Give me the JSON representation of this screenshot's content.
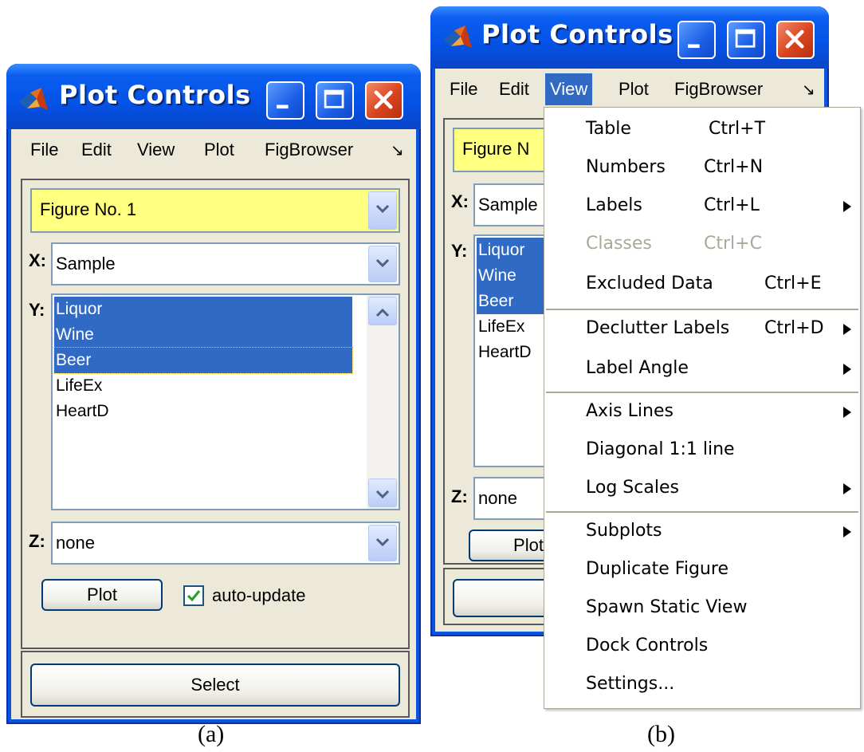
{
  "window_a": {
    "title": "Plot Controls",
    "menu": [
      "File",
      "Edit",
      "View",
      "Plot",
      "FigBrowser"
    ],
    "overflow_glyph": "↘",
    "figure_combo": "Figure No. 1",
    "x_label": "X:",
    "x_value": "Sample",
    "y_label": "Y:",
    "y_items": [
      {
        "text": "Liquor",
        "selected": true
      },
      {
        "text": "Wine",
        "selected": true
      },
      {
        "text": "Beer",
        "selected": true
      },
      {
        "text": "LifeEx",
        "selected": false
      },
      {
        "text": "HeartD",
        "selected": false
      }
    ],
    "z_label": "Z:",
    "z_value": "none",
    "plot_button": "Plot",
    "auto_update_label": "auto-update",
    "auto_update_checked": true,
    "select_button": "Select"
  },
  "window_b": {
    "title": "Plot Controls",
    "menu": [
      "File",
      "Edit",
      "View",
      "Plot",
      "FigBrowser"
    ],
    "active_menu": "View",
    "overflow_glyph": "↘",
    "figure_combo": "Figure N",
    "x_label": "X:",
    "x_value": "Sample",
    "y_label": "Y:",
    "y_items": [
      {
        "text": "Liquor",
        "selected": true
      },
      {
        "text": "Wine",
        "selected": true
      },
      {
        "text": "Beer",
        "selected": true
      },
      {
        "text": "LifeEx",
        "selected": false
      },
      {
        "text": "HeartD",
        "selected": false
      }
    ],
    "z_label": "Z:",
    "z_value": "none",
    "plot_button": "Plot"
  },
  "view_menu": {
    "items": [
      {
        "label": "Table",
        "shortcut": "Ctrl+T",
        "submenu": false,
        "disabled": false
      },
      {
        "label": "Numbers",
        "shortcut": "Ctrl+N",
        "submenu": false,
        "disabled": false
      },
      {
        "label": "Labels",
        "shortcut": "Ctrl+L",
        "submenu": true,
        "disabled": false
      },
      {
        "label": "Classes",
        "shortcut": "Ctrl+C",
        "submenu": false,
        "disabled": true
      },
      {
        "label": "Excluded Data",
        "shortcut": "Ctrl+E",
        "submenu": false,
        "disabled": false
      },
      {
        "label": "Declutter Labels",
        "shortcut": "Ctrl+D",
        "submenu": true,
        "disabled": false
      },
      {
        "label": "Label Angle",
        "shortcut": "",
        "submenu": true,
        "disabled": false
      },
      {
        "label": "Axis Lines",
        "shortcut": "",
        "submenu": true,
        "disabled": false
      },
      {
        "label": "Diagonal 1:1 line",
        "shortcut": "",
        "submenu": false,
        "disabled": false
      },
      {
        "label": "Log Scales",
        "shortcut": "",
        "submenu": true,
        "disabled": false
      },
      {
        "label": "Subplots",
        "shortcut": "",
        "submenu": true,
        "disabled": false
      },
      {
        "label": "Duplicate Figure",
        "shortcut": "",
        "submenu": false,
        "disabled": false
      },
      {
        "label": "Spawn Static View",
        "shortcut": "",
        "submenu": false,
        "disabled": false
      },
      {
        "label": "Dock Controls",
        "shortcut": "",
        "submenu": false,
        "disabled": false
      },
      {
        "label": "Settings...",
        "shortcut": "",
        "submenu": false,
        "disabled": false
      }
    ],
    "submenu_arrow": "▶"
  },
  "captions": {
    "a": "(a)",
    "b": "(b)"
  },
  "colors": {
    "titlebar": "#0a55e0",
    "selection": "#316ac5",
    "figure_combo_bg": "#ffff80",
    "close_button": "#d9431e"
  }
}
